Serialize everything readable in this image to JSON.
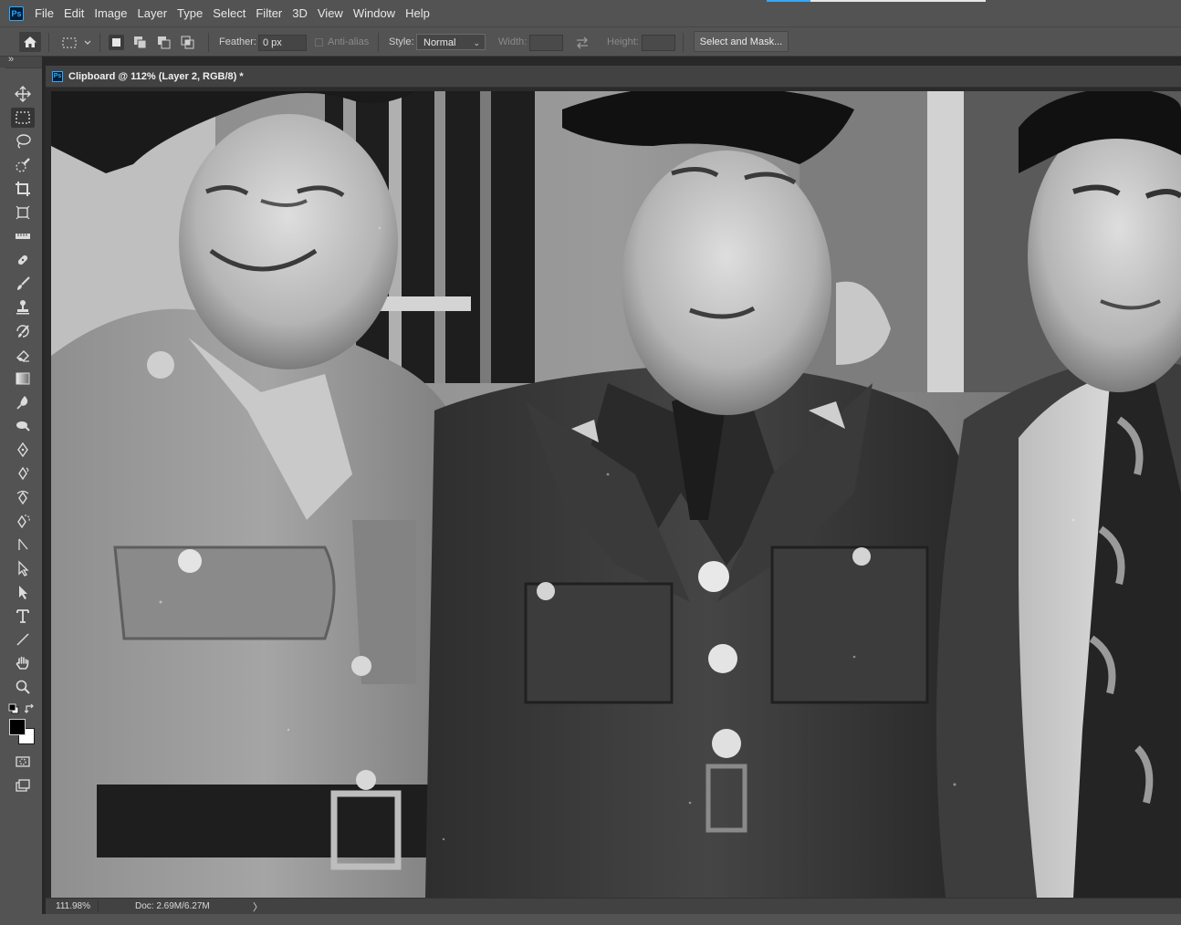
{
  "app": {
    "logo_text": "Ps",
    "menu": [
      "File",
      "Edit",
      "Image",
      "Layer",
      "Type",
      "Select",
      "Filter",
      "3D",
      "View",
      "Window",
      "Help"
    ]
  },
  "options_bar": {
    "feather_label": "Feather:",
    "feather_value": "0 px",
    "antialias_label": "Anti-alias",
    "style_label": "Style:",
    "style_value": "Normal",
    "width_label": "Width:",
    "height_label": "Height:",
    "select_mask_label": "Select and Mask..."
  },
  "tools": {
    "collapse_glyph": "»",
    "items": [
      "move-tool",
      "rectangular-marquee-tool",
      "lasso-tool",
      "quick-selection-tool",
      "crop-tool",
      "frame-tool",
      "ruler-tool",
      "spot-healing-brush-tool",
      "brush-tool",
      "clone-stamp-tool",
      "history-brush-tool",
      "eraser-tool",
      "gradient-tool",
      "blur-tool",
      "dodge-tool",
      "pen-tool",
      "freeform-pen-tool",
      "curvature-pen-tool",
      "content-aware-tracing-tool",
      "path-selection-tool",
      "direct-selection-tool",
      "select-arrow-tool",
      "type-tool",
      "line-tool",
      "hand-tool",
      "zoom-tool"
    ],
    "active": "rectangular-marquee-tool",
    "foreground_color": "#000000",
    "background_color": "#ffffff"
  },
  "document": {
    "ps_badge": "Ps",
    "tab_title": "Clipboard @ 112% (Layer 2, RGB/8) *",
    "zoom": "111.98%",
    "doc_size": "Doc: 2.69M/6.27M",
    "status_arrow": "〉"
  },
  "colors": {
    "ui_background": "#535353",
    "panel_dark": "#424242",
    "accent": "#31a8ff"
  }
}
